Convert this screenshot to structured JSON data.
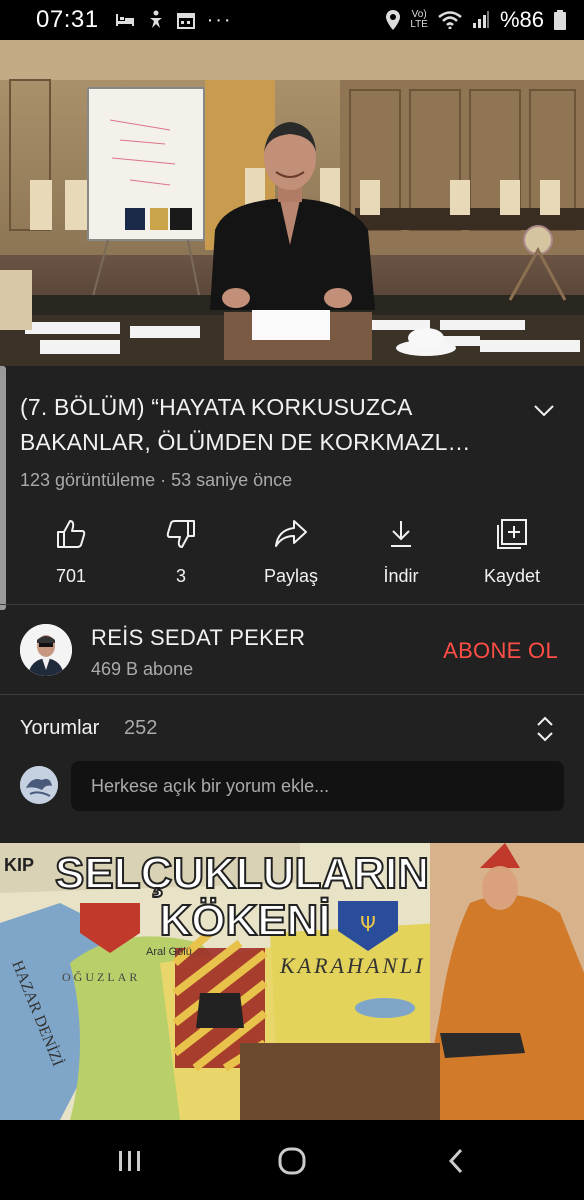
{
  "status_bar": {
    "time": "07:31",
    "battery": "%86",
    "network": "LTE",
    "left_icons": [
      "bed-icon",
      "accessibility-icon",
      "calendar-icon",
      "more-dots-icon"
    ],
    "right_icons": [
      "location-icon",
      "volte-icon",
      "wifi-icon",
      "signal-icon",
      "battery-icon"
    ]
  },
  "video": {
    "title": "(7. BÖLÜM) “HAYATA KORKUSUZCA BAKANLAR, ÖLÜMDEN DE KORKMAZL…",
    "meta": "123 görüntüleme · 53 saniye önce"
  },
  "actions": [
    {
      "icon": "thumbs-up-icon",
      "label": "701"
    },
    {
      "icon": "thumbs-down-icon",
      "label": "3"
    },
    {
      "icon": "share-icon",
      "label": "Paylaş"
    },
    {
      "icon": "download-icon",
      "label": "İndir"
    },
    {
      "icon": "save-playlist-icon",
      "label": "Kaydet"
    }
  ],
  "channel": {
    "name": "REİS SEDAT PEKER",
    "subscribers": "469 B abone",
    "subscribe_label": "ABONE OL"
  },
  "comments": {
    "title": "Yorumlar",
    "count": "252",
    "placeholder": "Herkese açık bir yorum ekle..."
  },
  "next_video": {
    "headline_line1": "SELÇUKLULARIN",
    "headline_line2": "KÖKENİ",
    "map_labels": [
      "KIP",
      "HAZAR DENİZİ",
      "OĞUZLAR",
      "KARAHANLI",
      "Aral Gölü"
    ]
  },
  "colors": {
    "background": "#212121",
    "subscribe": "#ff4e45",
    "secondary_text": "#aaaaaa"
  }
}
